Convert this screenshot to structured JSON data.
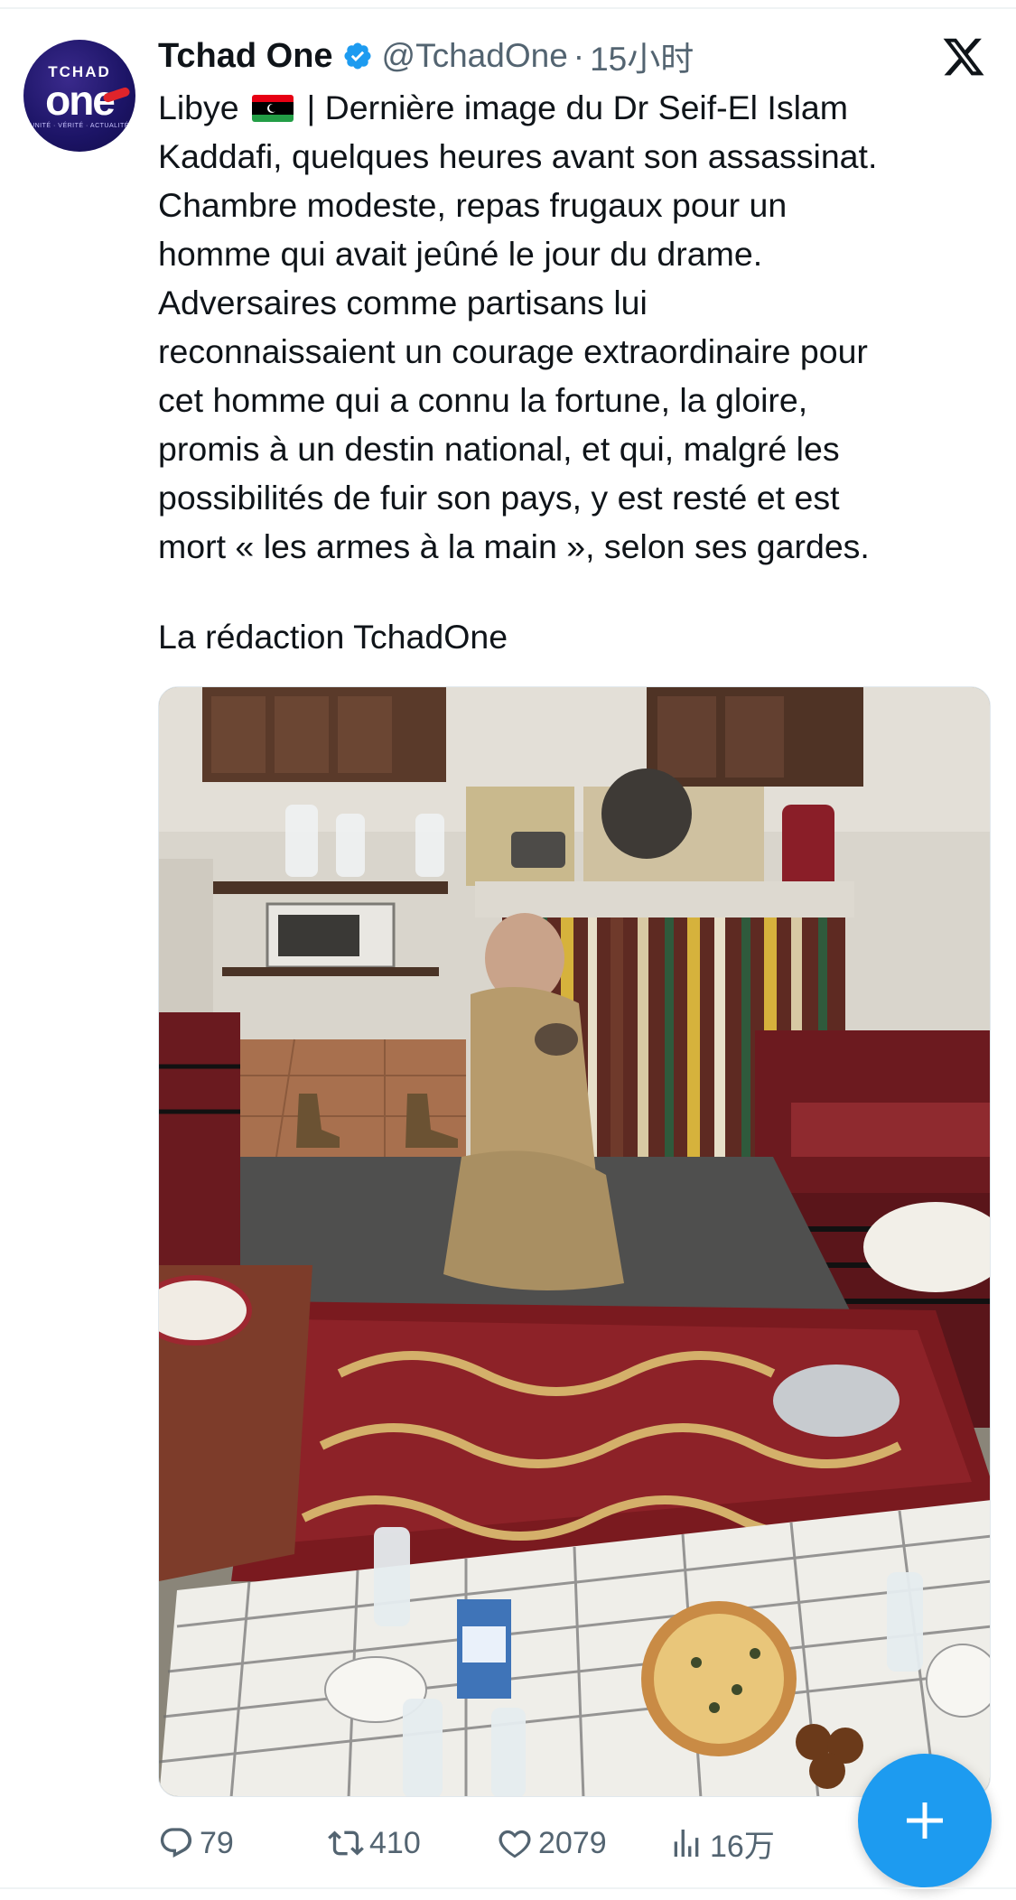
{
  "tweet": {
    "author": {
      "display_name": "Tchad One",
      "handle": "@TchadOne",
      "verified": true,
      "avatar_brand": "TCHAD",
      "avatar_wordmark": "one",
      "avatar_tagline": "UNITÉ · VÉRITÉ · ACTUALITÉ"
    },
    "separator": "·",
    "time": "15小时",
    "lines": [
      "| Dernière image du Dr Seif-El Islam",
      "Kaddafi, quelques heures avant son assassinat.",
      "Chambre modeste, repas frugaux pour un",
      "homme qui avait jeûné le jour du drame.",
      "Adversaires comme partisans lui",
      "reconnaissaient un courage extraordinaire pour",
      "cet homme qui a connu la fortune, la gloire,",
      "promis à un destin national, et qui, malgré les",
      "possibilités de fuir son pays, y est resté et est",
      "mort « les armes à la main », selon ses gardes."
    ],
    "country_label": "Libye",
    "signature": "La rédaction TchadOne",
    "media": {
      "description_icon": "photo"
    },
    "stats": {
      "replies": "79",
      "retweets": "410",
      "likes": "2079",
      "views": "16万"
    }
  },
  "colors": {
    "text_primary": "#0f1419",
    "text_secondary": "#536471",
    "verified_blue": "#1d9bf0",
    "fab_blue": "#1d9bf0"
  },
  "icons": {
    "reply": "reply-icon",
    "retweet": "retweet-icon",
    "like": "heart-icon",
    "views": "analytics-icon",
    "fab": "plus-icon",
    "platform": "x-logo-icon"
  }
}
